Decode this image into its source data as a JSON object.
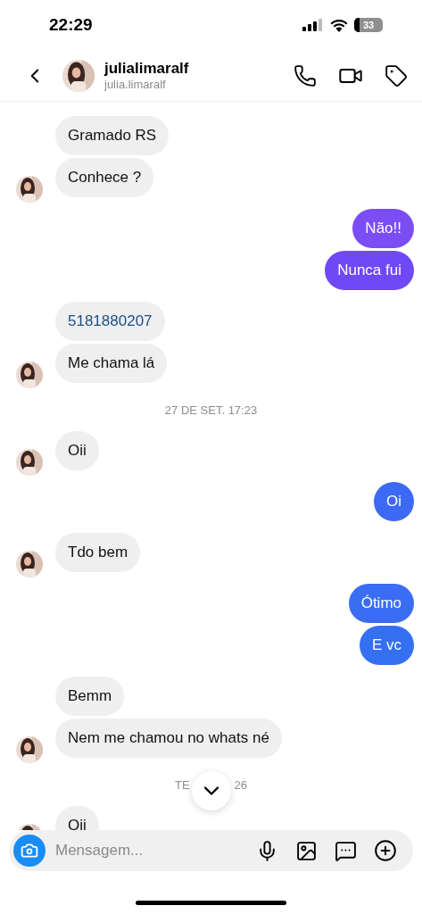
{
  "status_bar": {
    "time": "22:29",
    "battery": "33"
  },
  "header": {
    "name": "julialimaralf",
    "username": "julia.limaralf"
  },
  "messages": [
    {
      "kind": "incoming",
      "bubbles": [
        {
          "text": "Gramado RS",
          "link": false
        },
        {
          "text": "Conhece ?",
          "link": false
        }
      ]
    },
    {
      "kind": "outgoing",
      "bubbles": [
        {
          "text": "Não!!",
          "color": "#7b4df5"
        },
        {
          "text": "Nunca fui",
          "color": "#7048f6"
        }
      ]
    },
    {
      "kind": "incoming",
      "bubbles": [
        {
          "text": "5181880207",
          "link": true
        },
        {
          "text": "Me chama lá",
          "link": false
        }
      ]
    },
    {
      "kind": "date",
      "text": "27 DE SET. 17:23"
    },
    {
      "kind": "incoming",
      "bubbles": [
        {
          "text": "Oii",
          "link": false
        }
      ]
    },
    {
      "kind": "outgoing",
      "bubbles": [
        {
          "text": "Oi",
          "color": "#3d6af5"
        }
      ]
    },
    {
      "kind": "incoming",
      "bubbles": [
        {
          "text": "Tdo bem",
          "link": false
        }
      ]
    },
    {
      "kind": "outgoing",
      "bubbles": [
        {
          "text": "Ótimo",
          "color": "#3a6df3"
        },
        {
          "text": "E vc",
          "color": "#3570f2"
        }
      ]
    },
    {
      "kind": "incoming",
      "bubbles": [
        {
          "text": "Bemm",
          "link": false
        },
        {
          "text": "Nem me chamou no whats né",
          "link": false
        }
      ]
    },
    {
      "kind": "date",
      "text": "TE",
      "text_after": "26"
    },
    {
      "kind": "incoming",
      "bubbles": [
        {
          "text": "Oii",
          "link": false
        }
      ]
    }
  ],
  "composer": {
    "placeholder": "Mensagem..."
  }
}
